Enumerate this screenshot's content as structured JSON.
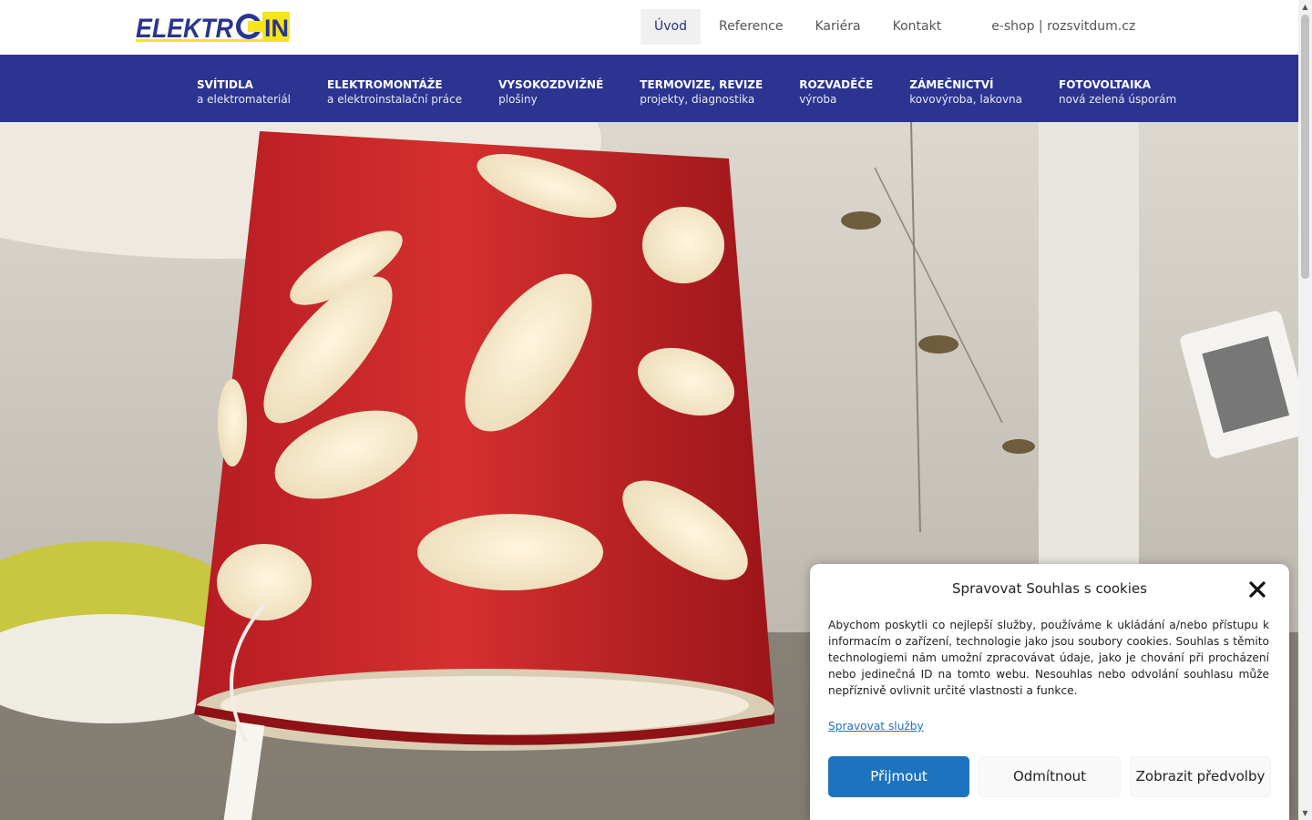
{
  "brand": {
    "logo_text_left": "ELEKTR",
    "logo_text_right": "IN",
    "colors": {
      "blue": "#2b3491",
      "yellow": "#f4e51c"
    }
  },
  "topnav": [
    {
      "label": "Úvod",
      "active": true
    },
    {
      "label": "Reference"
    },
    {
      "label": "Kariéra"
    },
    {
      "label": "Kontakt"
    },
    {
      "label": "e-shop | rozsvitdum.cz"
    }
  ],
  "categories": [
    {
      "title": "SVÍTIDLA",
      "subtitle": "a elektromateriál"
    },
    {
      "title": "ELEKTROMONTÁŽE",
      "subtitle": "a elektroinstalační práce"
    },
    {
      "title": "VYSOKOZDVIŽNÉ",
      "subtitle": "plošiny"
    },
    {
      "title": "TERMOVIZE, REVIZE",
      "subtitle": "projekty, diagnostika"
    },
    {
      "title": "ROZVADĚČE",
      "subtitle": "výroba"
    },
    {
      "title": "ZÁMEČNICTVÍ",
      "subtitle": "kovovýroba, lakovna"
    },
    {
      "title": "FOTOVOLTAIKA",
      "subtitle": "nová zelená úsporám"
    }
  ],
  "hero": {
    "image": "red-perforated-lampshade-photo",
    "lamp_color": "#c8262a"
  },
  "cookie": {
    "title": "Spravovat Souhlas s cookies",
    "close_icon": "close-icon",
    "text": "Abychom poskytli co nejlepší služby, používáme k ukládání a/nebo přístupu k informacím o zařízení, technologie jako jsou soubory cookies. Souhlas s těmito technologiemi nám umožní zpracovávat údaje, jako je chování při procházení nebo jedinečná ID na tomto webu. Nesouhlas nebo odvolání souhlasu může nepříznivě ovlivnit určité vlastnosti a funkce.",
    "manage_link": "Spravovat služby",
    "accept": "Přijmout",
    "deny": "Odmítnout",
    "preferences": "Zobrazit předvolby",
    "accent": "#1e73be"
  }
}
